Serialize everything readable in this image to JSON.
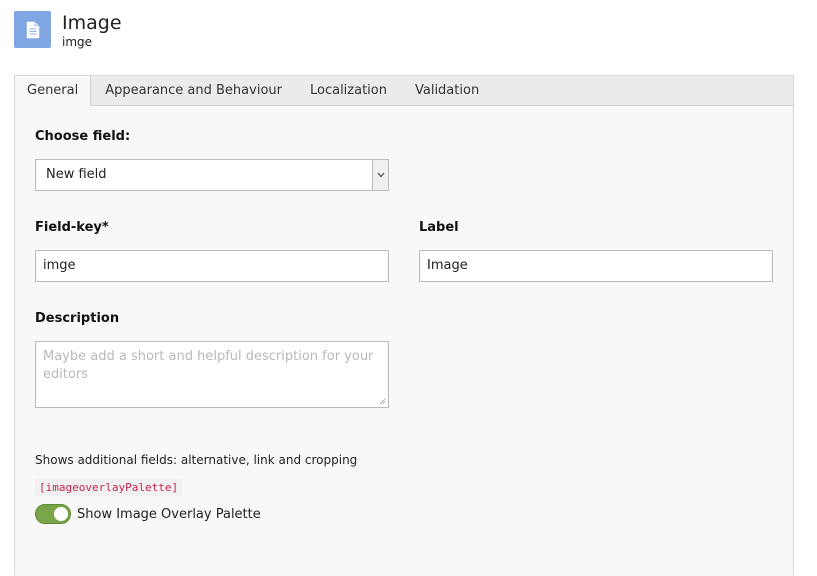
{
  "header": {
    "title": "Image",
    "subtitle": "imge",
    "icon": "document-icon"
  },
  "tabs": [
    "General",
    "Appearance and Behaviour",
    "Localization",
    "Validation"
  ],
  "form": {
    "choose_field_label": "Choose field:",
    "choose_field_value": "New field",
    "field_key_label": "Field-key*",
    "field_key_value": "imge",
    "label_label": "Label",
    "label_value": "Image",
    "description_label": "Description",
    "description_placeholder": "Maybe add a short and helpful description for your editors",
    "hint": "Shows additional fields: alternative, link and cropping",
    "palette_code": "[imageoverlayPalette]",
    "toggle_label": "Show Image Overlay Palette",
    "toggle_on": true
  },
  "colors": {
    "accent": "#79a548",
    "icon_bg": "#7fa6e3"
  }
}
